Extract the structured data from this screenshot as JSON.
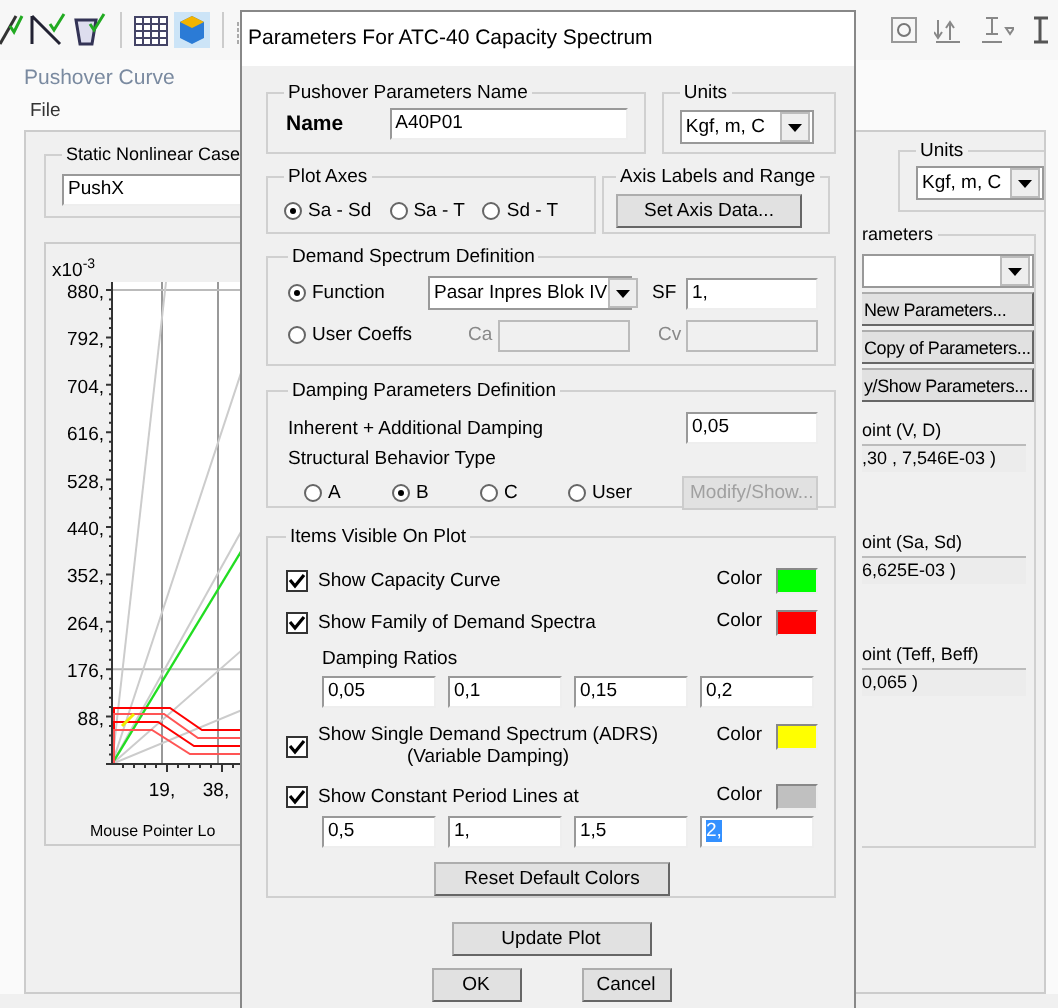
{
  "window": {
    "title": "Pushover Curve",
    "menu": [
      {
        "label": "File"
      }
    ]
  },
  "static_case": {
    "label": "Static Nonlinear Case",
    "value": "PushX"
  },
  "plot": {
    "y_scale": "x10$^{-3}$",
    "y_ticks": [
      "880,",
      "792,",
      "704,",
      "616,",
      "528,",
      "440,",
      "352,",
      "264,",
      "176,",
      "88,"
    ],
    "x_ticks": [
      "19,",
      "38,"
    ],
    "footer": "Mouse Pointer Lo"
  },
  "units": {
    "label": "Units",
    "value": "Kgf, m, C"
  },
  "parameters": {
    "label": "rameters",
    "buttons": [
      "New Parameters...",
      "Copy of Parameters...",
      "y/Show Parameters..."
    ],
    "results": [
      {
        "label": "oint (V, D)",
        "value": ",30 , 7,546E-03 )"
      },
      {
        "label": "oint (Sa, Sd)",
        "value": "6,625E-03 )"
      },
      {
        "label": "oint (Teff, Beff)",
        "value": "0,065 )"
      }
    ]
  },
  "dialog": {
    "title": "Parameters For ATC-40 Capacity Spectrum",
    "name_group": {
      "label": "Pushover Parameters Name",
      "field_label": "Name",
      "value": "A40P01"
    },
    "units": {
      "label": "Units",
      "value": "Kgf, m, C"
    },
    "plot_axes": {
      "label": "Plot Axes",
      "options": [
        {
          "label": "Sa - Sd",
          "selected": true
        },
        {
          "label": "Sa - T",
          "selected": false
        },
        {
          "label": "Sd - T",
          "selected": false
        }
      ]
    },
    "axis_range": {
      "label": "Axis Labels and Range",
      "button": "Set Axis Data..."
    },
    "demand": {
      "label": "Demand Spectrum Definition",
      "options": [
        {
          "label": "Function",
          "selected": true
        },
        {
          "label": "User Coeffs",
          "selected": false
        }
      ],
      "function": "Pasar Inpres Blok IV",
      "sf_label": "SF",
      "sf": "1,",
      "coeffs": [
        {
          "label": "Ca",
          "disabled": true
        },
        {
          "label": "Cv",
          "disabled": true
        }
      ]
    },
    "damping": {
      "label": "Damping Parameters Definition",
      "damping_label": "Inherent + Additional Damping",
      "damping": "0,05",
      "behavior_label": "Structural Behavior Type",
      "behavior": [
        {
          "label": "A",
          "selected": false
        },
        {
          "label": "B",
          "selected": true
        },
        {
          "label": "C",
          "selected": false
        },
        {
          "label": "User",
          "selected": false
        }
      ],
      "modify_button": {
        "label": "Modify/Show...",
        "disabled": true
      }
    },
    "items": {
      "label": "Items Visible On Plot",
      "list": [
        {
          "label": "Show Capacity Curve",
          "checked": true,
          "color_label": "Color",
          "color": "#00ff00"
        },
        {
          "label": "Show Family of Demand Spectra",
          "checked": true,
          "color_label": "Color",
          "color": "#ff0000",
          "values_label": "Damping Ratios",
          "values": [
            {
              "text": "0,05",
              "selected": false
            },
            {
              "text": "0,1",
              "selected": false
            },
            {
              "text": "0,15",
              "selected": false
            },
            {
              "text": "0,2",
              "selected": false
            }
          ]
        },
        {
          "label": "Show Single  Demand Spectrum (ADRS)",
          "sublabel": "(Variable Damping)",
          "checked": true,
          "color_label": "Color",
          "color": "#ffff00"
        },
        {
          "label": "Show Constant Period Lines at",
          "checked": true,
          "color_label": "Color",
          "color": "#c0c0c0",
          "values": [
            {
              "text": "0,5",
              "selected": false
            },
            {
              "text": "1,",
              "selected": false
            },
            {
              "text": "1,5",
              "selected": false
            },
            {
              "text": "2,",
              "selected": true
            }
          ]
        }
      ],
      "reset_button": "Reset Default Colors"
    },
    "update_button": "Update Plot",
    "buttons": [
      "OK",
      "Cancel"
    ]
  }
}
